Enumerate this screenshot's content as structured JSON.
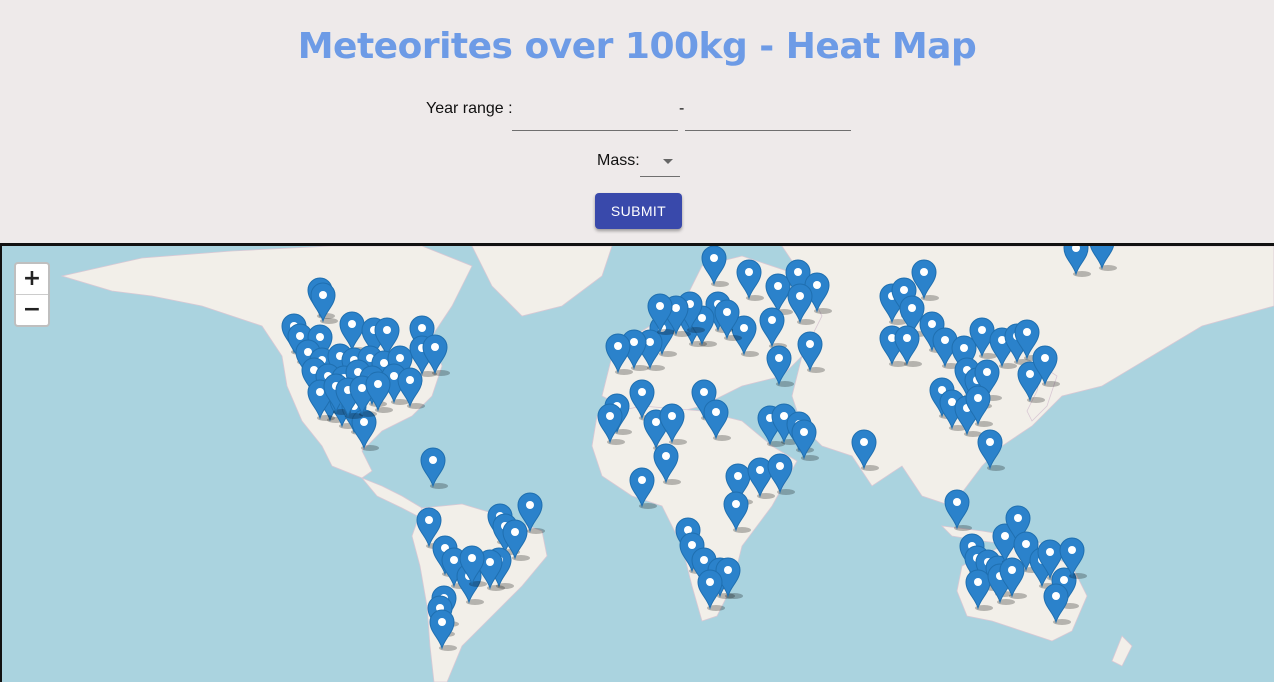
{
  "header": {
    "title": "Meteorites over 100kg - Heat Map"
  },
  "form": {
    "year_range_label": "Year range :",
    "year_range_separator": "-",
    "year_from_value": "",
    "year_to_value": "",
    "mass_label": "Mass:",
    "mass_value": "",
    "submit_label": "SUBMIT"
  },
  "map": {
    "zoom_in_label": "+",
    "zoom_out_label": "−",
    "colors": {
      "water": "#aad3df",
      "land": "#f2efe9",
      "border": "#c9a9c0",
      "marker": "#2b82cb",
      "marker_dark": "#1f6fb0"
    }
  }
}
